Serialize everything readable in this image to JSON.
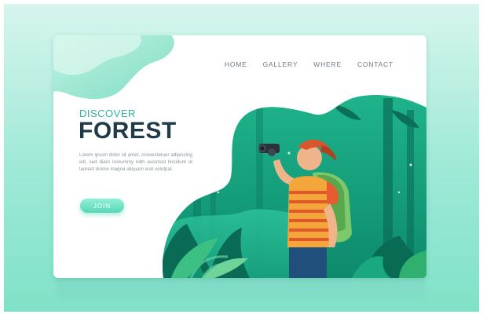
{
  "nav": {
    "items": [
      {
        "label": "HOME"
      },
      {
        "label": "GALLERY"
      },
      {
        "label": "WHERE"
      },
      {
        "label": "CONTACT"
      }
    ]
  },
  "hero": {
    "eyebrow": "DISCOVER",
    "title": "FOREST",
    "body": "Lorem ipsum dolor sit amet, consectetuer adipiscing elit, sed diam nonummy nibh euismod tincidunt ut laoreet dolore magna aliquam erat volutpat.",
    "cta_label": "JOIN"
  },
  "colors": {
    "accent": "#2fb39c",
    "title": "#1f3b48",
    "forest_dark": "#0b7a63",
    "forest_mid": "#16a382",
    "button": "#57d8b8",
    "shirt": "#f3a73a",
    "cap": "#d9552e"
  },
  "icons": {
    "binoculars": "binoculars-icon",
    "leaves": "leaf-icon"
  }
}
